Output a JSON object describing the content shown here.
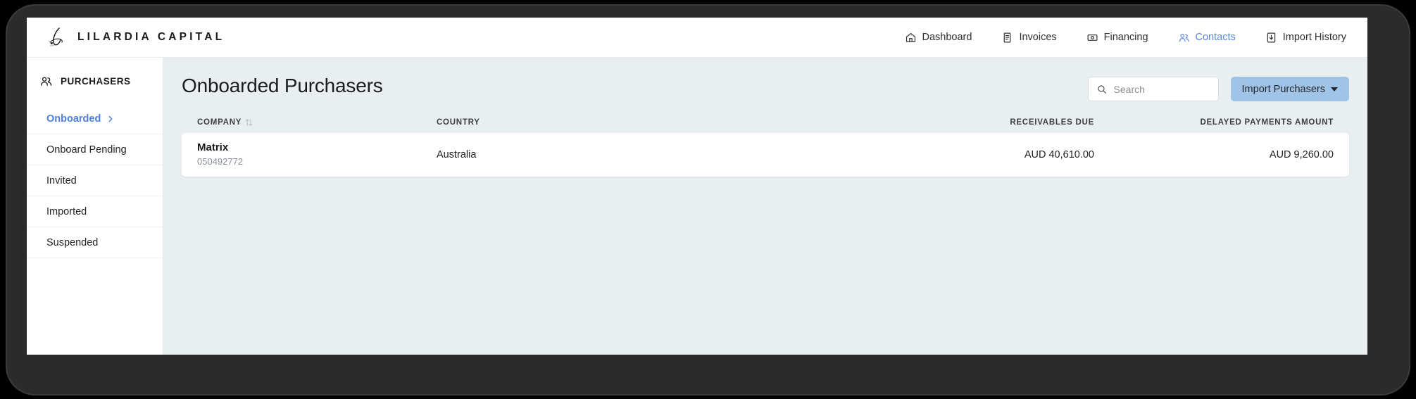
{
  "header": {
    "brand_name": "LILARDIA CAPITAL",
    "brand_mark": "script-l-logo",
    "nav": [
      {
        "label": "Dashboard",
        "icon": "home-icon",
        "active": false
      },
      {
        "label": "Invoices",
        "icon": "document-icon",
        "active": false
      },
      {
        "label": "Financing",
        "icon": "banknote-icon",
        "active": false
      },
      {
        "label": "Contacts",
        "icon": "people-icon",
        "active": true
      },
      {
        "label": "Import History",
        "icon": "download-box-icon",
        "active": false
      }
    ]
  },
  "sidebar": {
    "title": "PURCHASERS",
    "title_icon": "people-icon",
    "items": [
      {
        "label": "Onboarded",
        "active": true,
        "chevron": true
      },
      {
        "label": "Onboard Pending",
        "active": false,
        "chevron": false
      },
      {
        "label": "Invited",
        "active": false,
        "chevron": false
      },
      {
        "label": "Imported",
        "active": false,
        "chevron": false
      },
      {
        "label": "Suspended",
        "active": false,
        "chevron": false
      }
    ]
  },
  "main": {
    "page_title": "Onboarded Purchasers",
    "search": {
      "value": "",
      "placeholder": "Search",
      "icon": "search-icon"
    },
    "import_button": {
      "label": "Import Purchasers",
      "icon": "caret-down-icon"
    },
    "table": {
      "columns": [
        {
          "key": "company",
          "label": "COMPANY",
          "sortable": true
        },
        {
          "key": "country",
          "label": "COUNTRY",
          "sortable": false
        },
        {
          "key": "recv",
          "label": "RECEIVABLES DUE",
          "sortable": false
        },
        {
          "key": "delayed",
          "label": "DELAYED PAYMENTS AMOUNT",
          "sortable": false
        }
      ],
      "rows": [
        {
          "company": "Matrix",
          "company_id": "050492772",
          "country": "Australia",
          "receivables_due": "AUD 40,610.00",
          "delayed_payments_amount": "AUD 9,260.00"
        }
      ]
    }
  },
  "colors": {
    "accent_blue": "#5b86e0",
    "button_blue": "#a0c3e8",
    "content_bg": "#e9eef1",
    "frame_dark": "#2b2b2b"
  }
}
